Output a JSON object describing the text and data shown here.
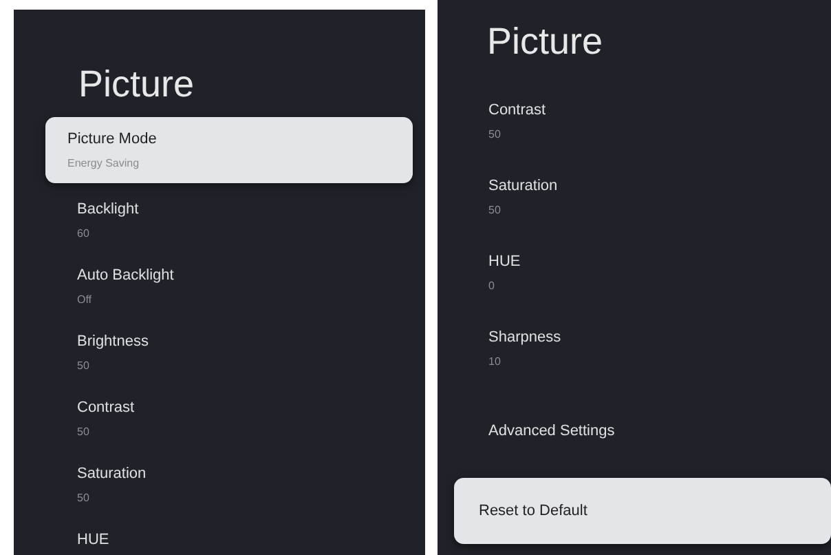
{
  "panels": [
    {
      "title": "Picture",
      "items": [
        {
          "label": "Picture Mode",
          "value": "Energy Saving",
          "selected": true
        },
        {
          "label": "Backlight",
          "value": "60",
          "selected": false
        },
        {
          "label": "Auto Backlight",
          "value": "Off",
          "selected": false
        },
        {
          "label": "Brightness",
          "value": "50",
          "selected": false
        },
        {
          "label": "Contrast",
          "value": "50",
          "selected": false
        },
        {
          "label": "Saturation",
          "value": "50",
          "selected": false
        },
        {
          "label": "HUE",
          "selected": false
        }
      ]
    },
    {
      "title": "Picture",
      "items": [
        {
          "label": "Contrast",
          "value": "50",
          "selected": false
        },
        {
          "label": "Saturation",
          "value": "50",
          "selected": false
        },
        {
          "label": "HUE",
          "value": "0",
          "selected": false
        },
        {
          "label": "Sharpness",
          "value": "10",
          "selected": false
        },
        {
          "label": "Advanced Settings",
          "selected": false
        },
        {
          "label": "Reset to Default",
          "selected": true
        }
      ]
    }
  ]
}
